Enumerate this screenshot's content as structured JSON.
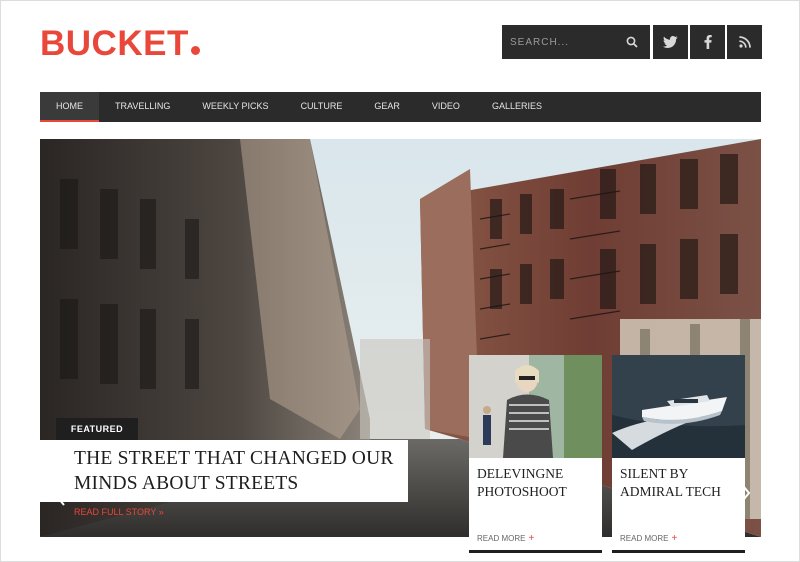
{
  "brand": {
    "name": "BUCKET",
    "accent": "#e8473a"
  },
  "search": {
    "placeholder": "SEARCH..."
  },
  "social": [
    {
      "icon": "twitter-icon"
    },
    {
      "icon": "facebook-icon"
    },
    {
      "icon": "rss-icon"
    }
  ],
  "nav": {
    "items": [
      "HOME",
      "TRAVELLING",
      "WEEKLY PICKS",
      "CULTURE",
      "GEAR",
      "VIDEO",
      "GALLERIES"
    ],
    "active": "HOME"
  },
  "featured": {
    "badge": "FEATURED",
    "title": "THE STREET THAT CHANGED OUR MINDS ABOUT STREETS",
    "link": "READ FULL STORY »"
  },
  "cards": [
    {
      "title": "DELEVINGNE PHOTOSHOOT",
      "more": "READ MORE",
      "plus": "+"
    },
    {
      "title": "SILENT BY ADMIRAL TECH",
      "more": "READ MORE",
      "plus": "+"
    }
  ]
}
